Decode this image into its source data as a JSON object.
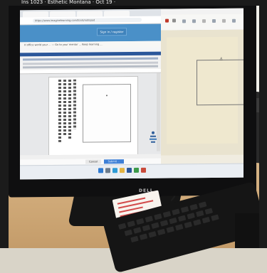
{
  "story_caption": "Ins 1023 · Esthetic Montana · Oct 19 ·",
  "monitor": {
    "brand": "DELL"
  },
  "left_window": {
    "tabs": [
      "",
      "",
      "",
      ""
    ],
    "url": "https://www.imaginelearning.com/tools/notepad",
    "sign_in_label": "Sign in / register",
    "banner_text": "H office world your ... — Go to your mentor ... Keep learning ...",
    "cancel_label": "Cancel",
    "submit_label": "Submit ..."
  },
  "right_window": {
    "anchor_glyph": "⚓"
  },
  "taskbar": {
    "time": "",
    "date": ""
  },
  "colors": {
    "browser_header": "#4a90c8",
    "word_titlebar": "#2b579a",
    "primary_button": "#3d7fd6",
    "sticker_red": "#d24a4a"
  }
}
